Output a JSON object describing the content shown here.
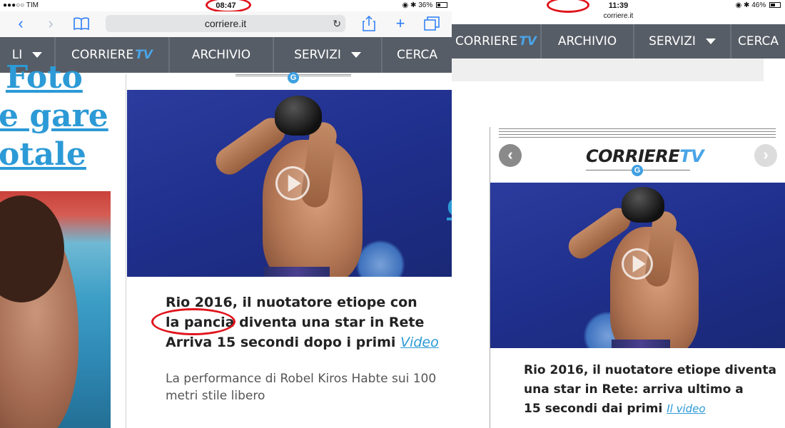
{
  "left": {
    "status": {
      "carrier": "●●●○○ TIM",
      "time": "08:47",
      "battery": "36%",
      "battery_level": 0.36
    },
    "browser": {
      "url": "corriere.it"
    },
    "nav": {
      "items": [
        "LI",
        "CORRIERE",
        "TV",
        "ARCHIVIO",
        "SERVIZI",
        "CERCA"
      ]
    },
    "headline_lines": [
      "Foto",
      "e gare",
      "otale"
    ],
    "right_edge_letter": "e",
    "article": {
      "title_lines": [
        "Rio 2016, il nuotatore etiope con",
        "la pancia diventa una star in Rete",
        "Arriva 15 secondi dopo i primi"
      ],
      "video_label": "Video",
      "subtitle_lines": [
        "La performance di Robel Kiros Habte sui 100",
        "metri stile libero"
      ]
    },
    "badge": "G"
  },
  "right": {
    "status": {
      "time": "11:39",
      "url": "corriere.it",
      "battery": "46%",
      "battery_level": 0.46
    },
    "nav": {
      "items": [
        "CORRIERE",
        "TV",
        "ARCHIVIO",
        "SERVIZI",
        "CERCA"
      ]
    },
    "logo": {
      "word": "CORRIERE",
      "tv": "TV"
    },
    "badge": "G",
    "article": {
      "title_lines": [
        "Rio 2016, il nuotatore etiope diventa",
        "una star in Rete: arriva ultimo a",
        "15 secondi dai primi"
      ],
      "video_label": "Il video"
    }
  },
  "colors": {
    "accent": "#2c9ad6",
    "nav_bg": "#575d66",
    "annotation": "#e0141c"
  },
  "icons": [
    "back-icon",
    "forward-icon",
    "bookmarks-icon",
    "reload-icon",
    "share-icon",
    "add-tab-icon",
    "tabs-icon",
    "play-icon",
    "prev-arrow-icon",
    "next-arrow-icon",
    "bluetooth-icon",
    "orientation-lock-icon",
    "wifi-icon",
    "battery-icon"
  ]
}
